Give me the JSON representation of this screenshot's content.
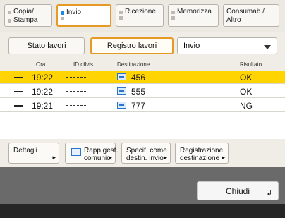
{
  "tabs": [
    {
      "line1": "Copia/",
      "line2": "Stampa"
    },
    {
      "line1": "Invio",
      "line2": ""
    },
    {
      "line1": "Ricezione",
      "line2": ""
    },
    {
      "line1": "Memorizza",
      "line2": ""
    },
    {
      "line1": "Consumab./",
      "line2": "Altro"
    }
  ],
  "subbar": {
    "stato": "Stato lavori",
    "registro": "Registro lavori",
    "dropdown_value": "Invio"
  },
  "table": {
    "headers": {
      "time": "Ora",
      "id": "ID dilvis.",
      "dest": "Destinazione",
      "result": "Risultato"
    },
    "rows": [
      {
        "time": "19:22",
        "dest": "456",
        "result": "OK"
      },
      {
        "time": "19:22",
        "dest": "555",
        "result": "OK"
      },
      {
        "time": "19:21",
        "dest": "777",
        "result": "NG"
      }
    ]
  },
  "actions": {
    "details": "Dettagli",
    "report_l1": "Rapp.gest.",
    "report_l2": "comunic.",
    "specify_l1": "Specif. come",
    "specify_l2": "destin. invio",
    "register_l1": "Registrazione",
    "register_l2": "destinazione"
  },
  "close": "Chiudi"
}
